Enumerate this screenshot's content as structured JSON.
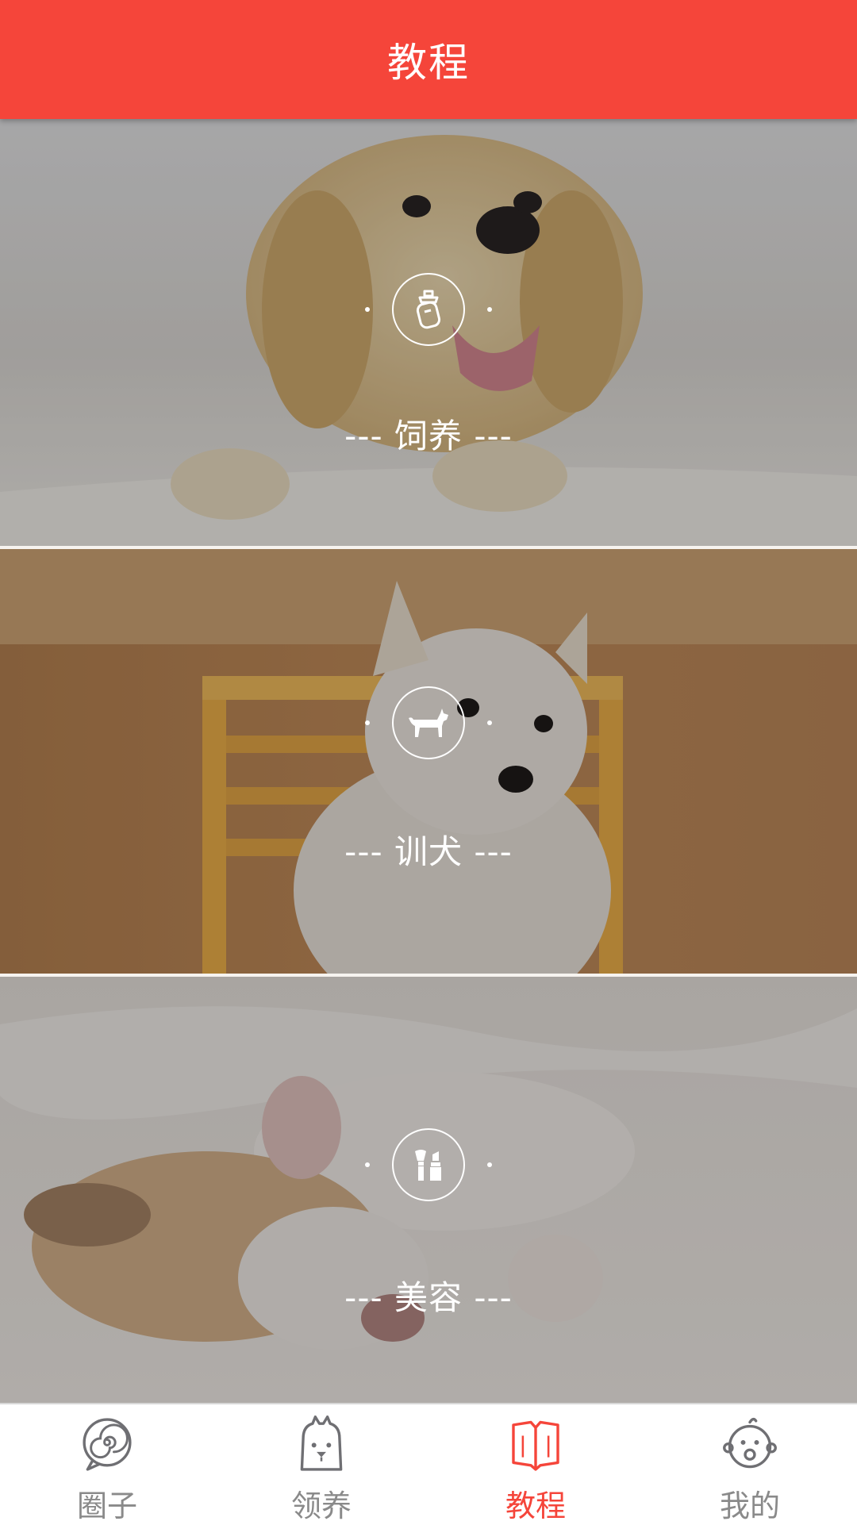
{
  "header": {
    "title": "教程"
  },
  "categories": [
    {
      "icon": "baby-bottle-icon",
      "label": "--- 饲养  ---"
    },
    {
      "icon": "dog-icon",
      "label": "--- 训犬 ---"
    },
    {
      "icon": "makeup-icon",
      "label": "--- 美容 ---"
    }
  ],
  "tabbar": {
    "active_index": 2,
    "tabs": [
      {
        "label": "圈子",
        "icon": "spiral-icon"
      },
      {
        "label": "领养",
        "icon": "pet-face-icon"
      },
      {
        "label": "教程",
        "icon": "open-book-icon"
      },
      {
        "label": "我的",
        "icon": "baby-face-icon"
      }
    ]
  },
  "colors": {
    "accent": "#f5453a",
    "tab_inactive": "#8a8a8a"
  }
}
